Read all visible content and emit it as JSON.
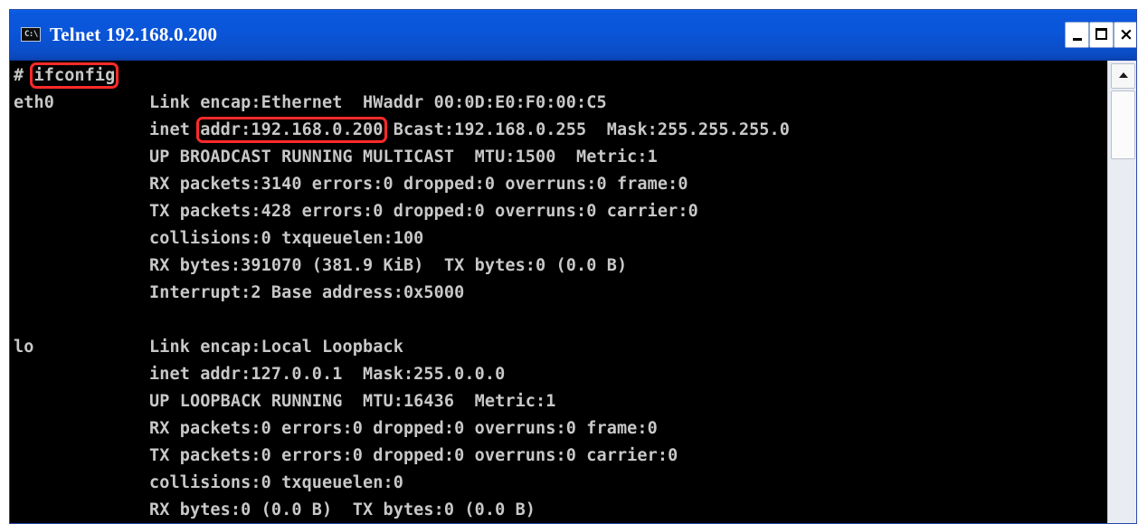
{
  "window": {
    "title": "Telnet 192.168.0.200",
    "app_icon_text": "C:\\",
    "controls": {
      "minimize": "minimize-icon",
      "maximize": "maximize-icon",
      "close": "close-icon",
      "close_glyph": "×"
    }
  },
  "terminal": {
    "prompt": "# ",
    "command": "ifconfig",
    "eth0": {
      "name": "eth0",
      "link": "Link encap:Ethernet  HWaddr 00:0D:E0:F0:00:C5",
      "inet_prefix": "inet ",
      "inet_addr": "addr:192.168.0.200",
      "inet_rest": " Bcast:192.168.0.255  Mask:255.255.255.0",
      "flags": "UP BROADCAST RUNNING MULTICAST  MTU:1500  Metric:1",
      "rx_packets": "RX packets:3140 errors:0 dropped:0 overruns:0 frame:0",
      "tx_packets": "TX packets:428 errors:0 dropped:0 overruns:0 carrier:0",
      "collisions": "collisions:0 txqueuelen:100",
      "bytes": "RX bytes:391070 (381.9 KiB)  TX bytes:0 (0.0 B)",
      "interrupt": "Interrupt:2 Base address:0x5000"
    },
    "lo": {
      "name": "lo",
      "link": "Link encap:Local Loopback",
      "inet": "inet addr:127.0.0.1  Mask:255.0.0.0",
      "flags": "UP LOOPBACK RUNNING  MTU:16436  Metric:1",
      "rx_packets": "RX packets:0 errors:0 dropped:0 overruns:0 frame:0",
      "tx_packets": "TX packets:0 errors:0 dropped:0 overruns:0 carrier:0",
      "collisions": "collisions:0 txqueuelen:0",
      "bytes": "RX bytes:0 (0.0 B)  TX bytes:0 (0.0 B)"
    }
  },
  "colors": {
    "terminal_bg": "#000000",
    "terminal_text": "#c8c8c8",
    "titlebar": "#0b58dd",
    "highlight": "#ff2a2a"
  }
}
